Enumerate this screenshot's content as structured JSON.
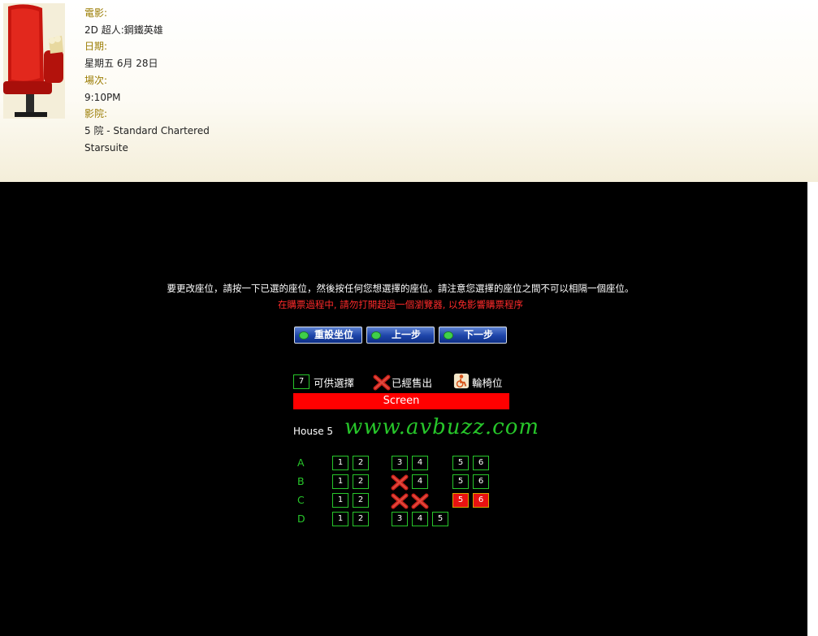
{
  "movie": {
    "film_label": "電影:",
    "film_value": "2D 超人:鋼鐵英雄",
    "date_label": "日期:",
    "date_value": "星期五 6月 28日",
    "time_label": "場次:",
    "time_value": "9:10PM",
    "cinema_label": "影院:",
    "cinema_value_line1": "5 院 - Standard Chartered",
    "cinema_value_line2": "Starsuite"
  },
  "messages": {
    "instruction": "要更改座位，請按一下已選的座位，然後按任何您想選擇的座位。請注意您選擇的座位之間不可以相隔一個座位。",
    "warning": "在購票過程中, 請勿打開超過一個瀏覽器, 以免影響購票程序"
  },
  "buttons": {
    "reset": "重設坐位",
    "back": "上一步",
    "next": "下一步"
  },
  "legend": {
    "sample_number": "7",
    "available": "可供選擇",
    "sold": "已經售出",
    "wheelchair": "輪椅位"
  },
  "screen_label": "Screen",
  "house_label": "House 5",
  "watermark": "www.avbuzz.com",
  "colors": {
    "available_border": "#27c62a",
    "selected_fill": "#e81212",
    "sold_x": "#c8201a",
    "screen": "#ff0000"
  },
  "seating": {
    "rows": [
      "A",
      "B",
      "C",
      "D"
    ],
    "seats": {
      "A": [
        {
          "num": "1",
          "state": "available"
        },
        {
          "num": "2",
          "state": "available"
        },
        {
          "num": "3",
          "state": "available"
        },
        {
          "num": "4",
          "state": "available"
        },
        {
          "num": "5",
          "state": "available"
        },
        {
          "num": "6",
          "state": "available"
        }
      ],
      "B": [
        {
          "num": "1",
          "state": "available"
        },
        {
          "num": "2",
          "state": "available"
        },
        {
          "num": "",
          "state": "sold"
        },
        {
          "num": "4",
          "state": "available"
        },
        {
          "num": "5",
          "state": "available"
        },
        {
          "num": "6",
          "state": "available"
        }
      ],
      "C": [
        {
          "num": "1",
          "state": "available"
        },
        {
          "num": "2",
          "state": "available"
        },
        {
          "num": "",
          "state": "sold"
        },
        {
          "num": "",
          "state": "sold"
        },
        {
          "num": "5",
          "state": "selected"
        },
        {
          "num": "6",
          "state": "selected"
        }
      ],
      "D": [
        {
          "num": "1",
          "state": "available"
        },
        {
          "num": "2",
          "state": "available"
        },
        {
          "num": "3",
          "state": "available"
        },
        {
          "num": "4",
          "state": "available"
        },
        {
          "num": "5",
          "state": "available"
        }
      ]
    }
  }
}
